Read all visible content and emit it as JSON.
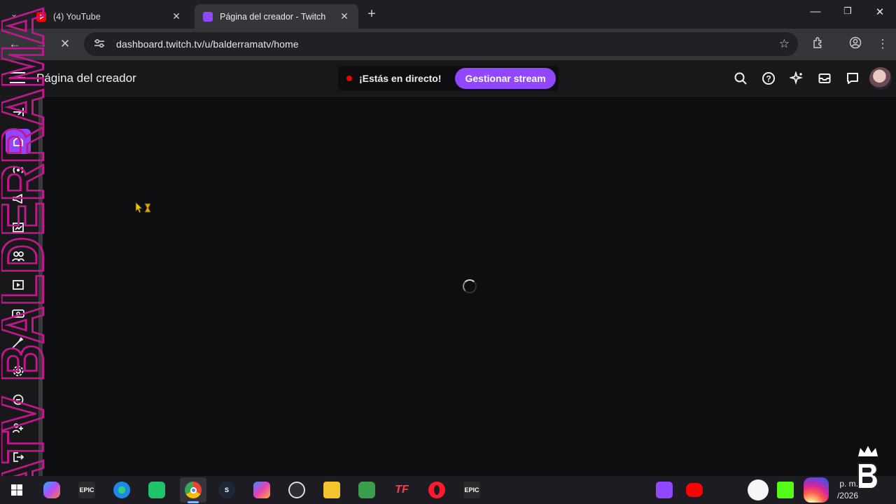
{
  "browser": {
    "tabs": [
      {
        "label": "(4) YouTube",
        "favicon": "youtube-icon",
        "active": false
      },
      {
        "label": "Página del creador - Twitch",
        "favicon": "twitch-icon",
        "active": true
      }
    ],
    "new_tab_label": "+",
    "url": "dashboard.twitch.tv/u/balderramatv/home"
  },
  "twitch": {
    "page_title": "Página del creador",
    "live_status": "¡Estás en directo!",
    "manage_stream_label": "Gestionar stream",
    "header_icons": [
      "search-icon",
      "help-icon",
      "sparkle-icon",
      "inbox-icon",
      "chat-icon",
      "avatar"
    ],
    "sidebar_icons": [
      "collapse-icon",
      "home-icon",
      "stream-icon",
      "promote-icon",
      "analytics-icon",
      "community-icon",
      "content-icon",
      "monetization-icon",
      "creator-tools-icon",
      "settings-icon",
      "viewer-rewards-icon",
      "extensions-icon",
      "exit-icon"
    ],
    "accent_color": "#9147ff",
    "live_color": "#eb0400",
    "loading": true
  },
  "overlay": {
    "watermark_text": "ATV BALDERRAMA",
    "watermark_color": "#c0188c"
  },
  "taskbar": {
    "apps": [
      "windows-start",
      "copilot",
      "epic-games",
      "edge",
      "app-green",
      "chrome",
      "steam",
      "m365",
      "obs",
      "file-explorer",
      "xbox-app",
      "tf-app",
      "opera",
      "epic-games"
    ],
    "clock_line1": "p. m.",
    "clock_line2": "/2026"
  }
}
